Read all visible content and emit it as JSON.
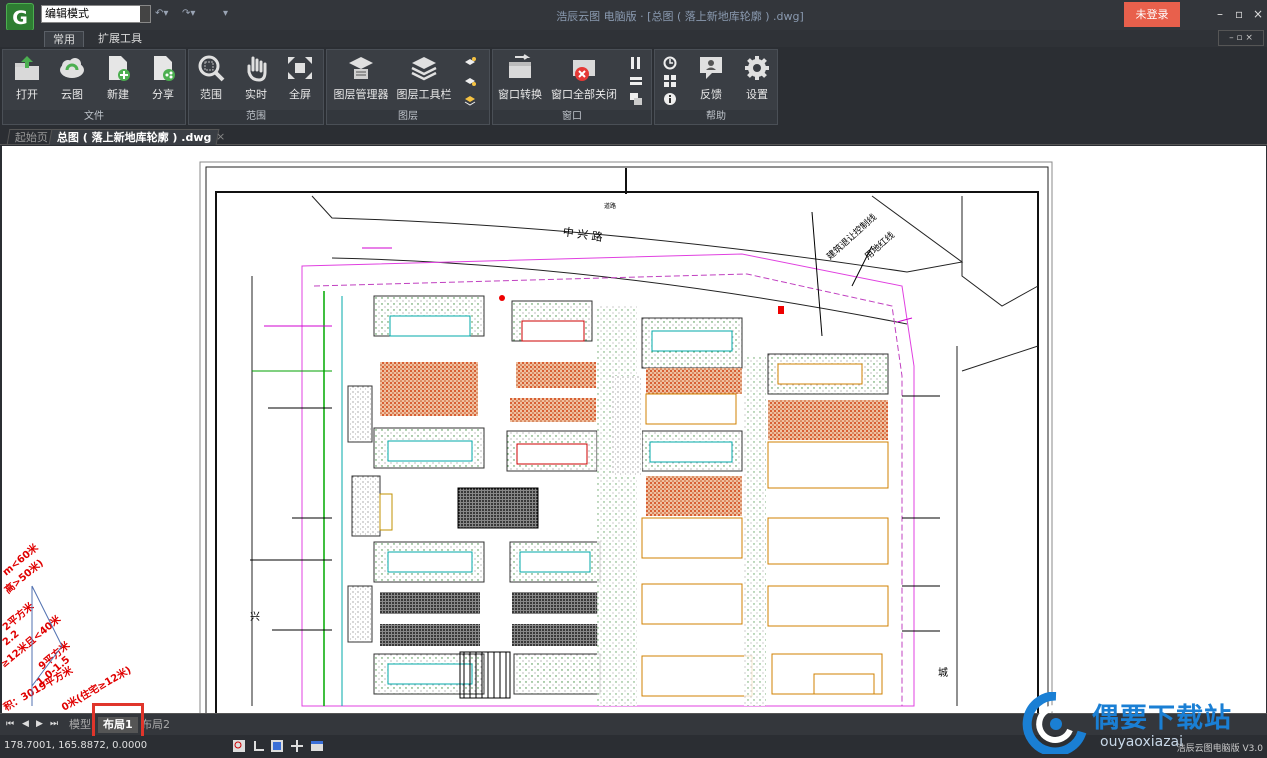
{
  "titlebar": {
    "mode": "编辑模式",
    "title": "浩辰云图 电脑版 · [总图 ( 落上新地库轮廓 ) .dwg]",
    "login_label": "未登录",
    "minimize": "–",
    "restore": "▫",
    "close": "×"
  },
  "ribbon_tabs": [
    "常用",
    "扩展工具"
  ],
  "groups": {
    "file": {
      "label": "文件",
      "buttons": [
        "打开",
        "云图",
        "新建",
        "分享"
      ]
    },
    "browse": {
      "label": "范围",
      "buttons": [
        "范围",
        "实时",
        "全屏"
      ],
      "group_label": "范围"
    },
    "layer": {
      "label": "图层",
      "buttons": [
        "图层管理器",
        "图层工具栏"
      ]
    },
    "window": {
      "label": "窗口",
      "buttons": [
        "窗口转换",
        "窗口全部关闭"
      ]
    },
    "help": {
      "label": "帮助",
      "buttons": [
        "反馈",
        "设置"
      ]
    }
  },
  "doc_tabs": [
    "起始页",
    "总图 ( 落上新地库轮廓 ) .dwg"
  ],
  "layout_tabs": [
    "模型",
    "布局1",
    "布局2"
  ],
  "status": {
    "coords": "178.7001, 165.8872, 0.0000",
    "right": "浩辰云图电脑版 V3.0"
  },
  "drawing_text": {
    "road_top": "中 兴 路",
    "road_left": "兴",
    "top_small": "道路",
    "diag1": "建筑退让控制线",
    "diag2": "用地红线",
    "right_edge": "城",
    "legend_lines": [
      "m<60米",
      "高>50米)",
      "2平方米",
      "2.2",
      "≥12米且<40米",
      "9平方米",
      "1.0-1.5",
      "积：3019平方米",
      "0米(住宅≥12米)"
    ]
  },
  "watermark": {
    "cn": "偶要下载站",
    "en": "ouyaoxiazai"
  }
}
